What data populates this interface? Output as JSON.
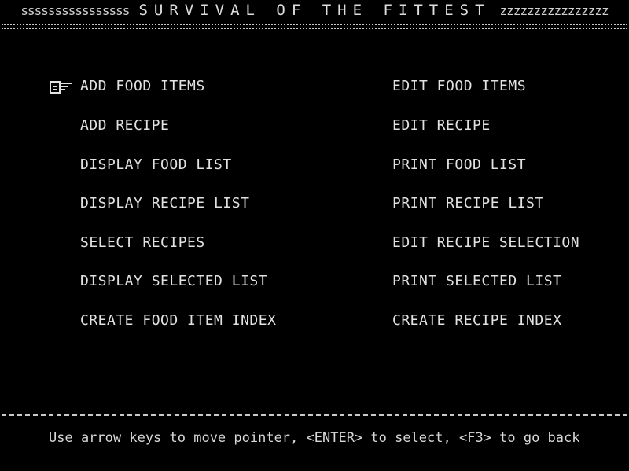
{
  "title": {
    "left_border": "ssssssssssssssss",
    "text": "SURVIVAL OF THE FITTEST",
    "right_border": "zzzzzzzzzzzzzzzz"
  },
  "menu": {
    "left": [
      {
        "label": "ADD FOOD ITEMS",
        "selected": true
      },
      {
        "label": "ADD RECIPE"
      },
      {
        "label": "DISPLAY FOOD LIST"
      },
      {
        "label": "DISPLAY RECIPE LIST"
      },
      {
        "label": "SELECT RECIPES"
      },
      {
        "label": "DISPLAY SELECTED LIST"
      },
      {
        "label": "CREATE FOOD ITEM INDEX"
      }
    ],
    "right": [
      {
        "label": "EDIT FOOD ITEMS"
      },
      {
        "label": "EDIT RECIPE"
      },
      {
        "label": "PRINT FOOD LIST"
      },
      {
        "label": "PRINT RECIPE LIST"
      },
      {
        "label": "EDIT RECIPE SELECTION"
      },
      {
        "label": "PRINT SELECTED LIST"
      },
      {
        "label": "CREATE RECIPE INDEX"
      }
    ]
  },
  "pointer_icon": "hand-pointer-icon",
  "help": "Use arrow keys to move pointer, <ENTER> to select, <F3> to go back",
  "colors": {
    "background": "#000000",
    "text": "#e2e2e2"
  }
}
